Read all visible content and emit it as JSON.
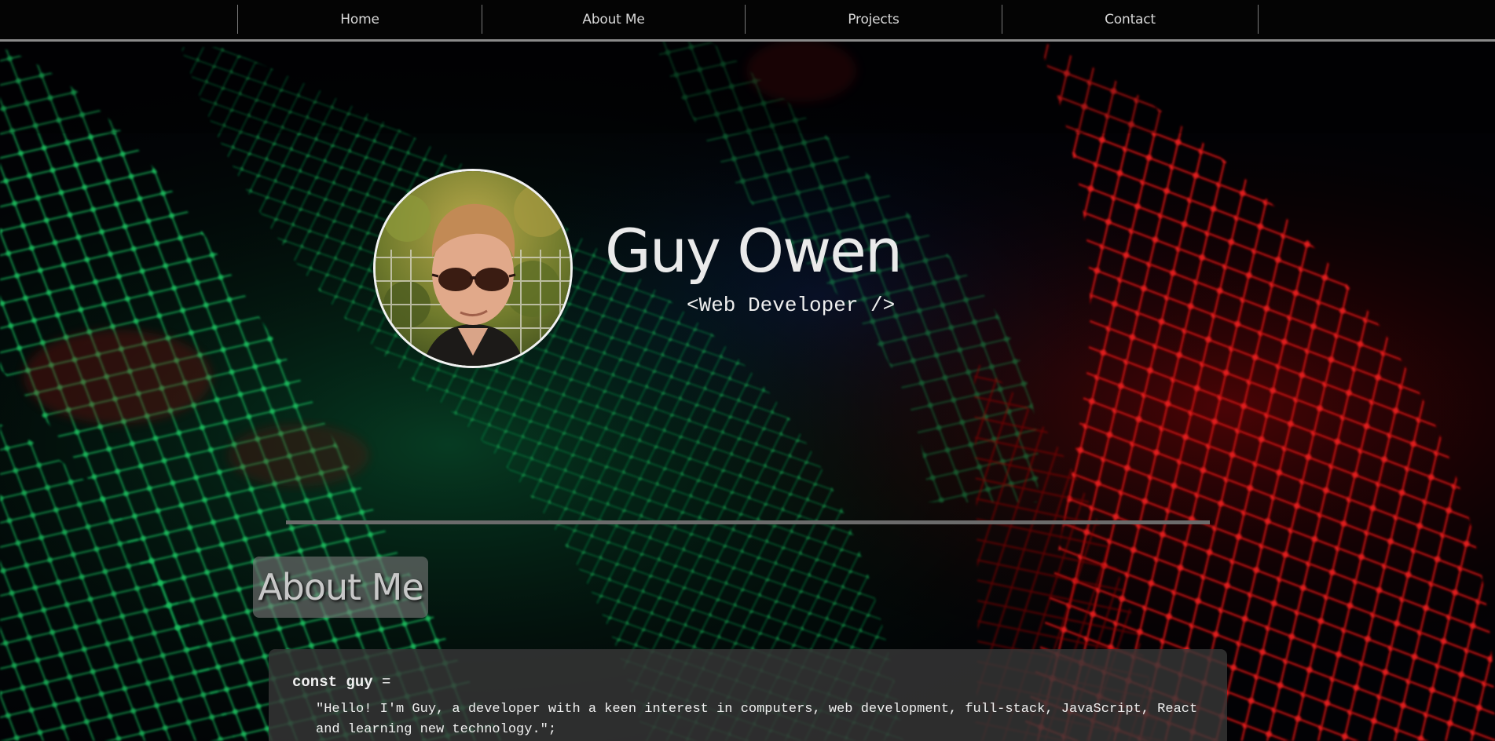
{
  "nav": {
    "items": [
      {
        "label": "Home"
      },
      {
        "label": "About Me"
      },
      {
        "label": "Projects"
      },
      {
        "label": "Contact"
      }
    ]
  },
  "hero": {
    "name": "Guy Owen",
    "tagline": "<Web Developer />",
    "avatar_icon": "profile-photo"
  },
  "about": {
    "heading": "About Me",
    "code_declaration": "const guy",
    "code_operator": " =",
    "code_string": "\"Hello! I'm Guy, a developer with a keen interest in computers, web development, full-stack, JavaScript, React and learning new technology.\";"
  },
  "colors": {
    "nav_background": "#040404",
    "nav_border": "#8a8a8a",
    "text_primary": "#eaeaea",
    "accent_green": "#0e9a4a",
    "accent_red": "#c81010"
  }
}
